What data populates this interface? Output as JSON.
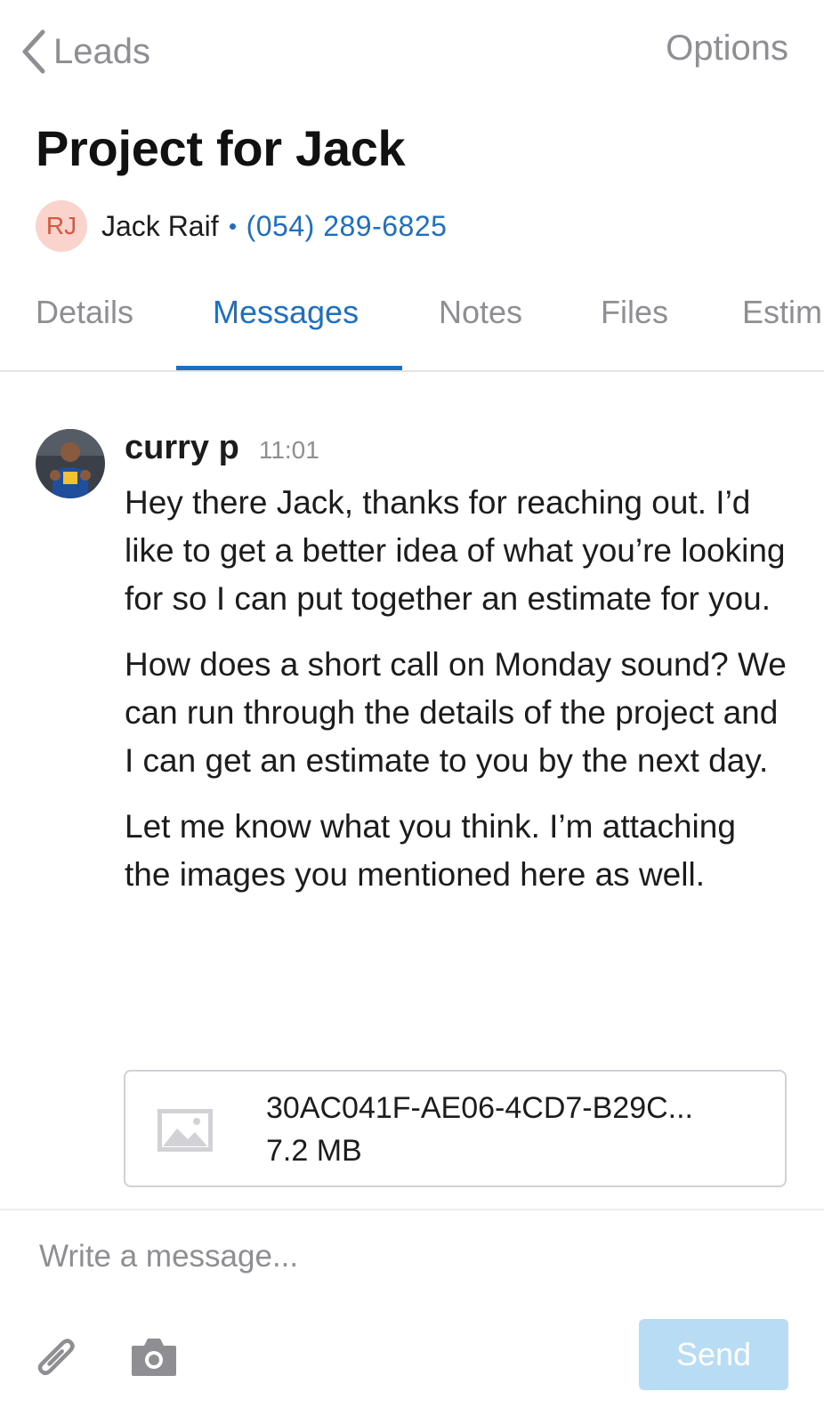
{
  "nav": {
    "back_label": "Leads",
    "options_label": "Options"
  },
  "project": {
    "title": "Project for Jack",
    "contact_initials": "RJ",
    "contact_name": "Jack Raif",
    "contact_phone": "(054) 289-6825"
  },
  "tabs": [
    {
      "label": "Details",
      "active": false
    },
    {
      "label": "Messages",
      "active": true
    },
    {
      "label": "Notes",
      "active": false
    },
    {
      "label": "Files",
      "active": false
    },
    {
      "label": "Estim",
      "active": false
    }
  ],
  "message": {
    "sender": "curry p",
    "time": "11:01",
    "paragraphs": [
      "Hey there Jack, thanks for reaching out. I’d like to get a better idea of what you’re looking for so I can put together an estimate for you.",
      "How does a short call on Monday sound? We can run through the details of the project and I can get an estimate to you by the next day.",
      "Let me know what you think. I’m attaching the images you mentioned here as well."
    ],
    "attachment": {
      "filename": "30AC041F-AE06-4CD7-B29C...",
      "size": "7.2 MB",
      "icon": "image-icon"
    }
  },
  "composer": {
    "placeholder": "Write a message...",
    "send_label": "Send"
  },
  "colors": {
    "accent": "#1f6fc1",
    "muted": "#8e8e93",
    "avatar_bg": "#fad3cc",
    "avatar_text": "#d9563f",
    "send_disabled": "#b9dcf5"
  },
  "icons": {
    "back": "chevron-left-icon",
    "attach": "paperclip-icon",
    "camera": "camera-icon"
  }
}
